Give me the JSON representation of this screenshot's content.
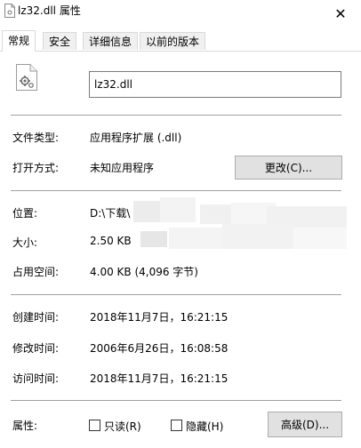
{
  "window": {
    "title": "lz32.dll 属性",
    "close_glyph": "✕"
  },
  "tabs": [
    {
      "label": "常规",
      "active": true
    },
    {
      "label": "安全",
      "active": false
    },
    {
      "label": "详细信息",
      "active": false
    },
    {
      "label": "以前的版本",
      "active": false
    }
  ],
  "general": {
    "file_name": "lz32.dll",
    "file_type_label": "文件类型:",
    "file_type_value": "应用程序扩展 (.dll)",
    "opens_with_label": "打开方式:",
    "opens_with_value": "未知应用程序",
    "change_button": "更改(C)...",
    "location_label": "位置:",
    "location_value": "D:\\下载\\",
    "size_label": "大小:",
    "size_value": "2.50 KB",
    "size_on_disk_label": "占用空间:",
    "size_on_disk_value": "4.00 KB (4,096 字节)",
    "created_label": "创建时间:",
    "created_value": "2018年11月7日，16:21:15",
    "modified_label": "修改时间:",
    "modified_value": "2006年6月26日，16:08:58",
    "accessed_label": "访问时间:",
    "accessed_value": "2018年11月7日，16:21:15",
    "attributes_label": "属性:",
    "readonly_label": "只读(R)",
    "readonly_checked": false,
    "hidden_label": "隐藏(H)",
    "hidden_checked": false,
    "advanced_button": "高级(D)..."
  },
  "icons": {
    "title_icon": "dll-file-icon",
    "file_icon": "dll-gear-file-icon"
  }
}
